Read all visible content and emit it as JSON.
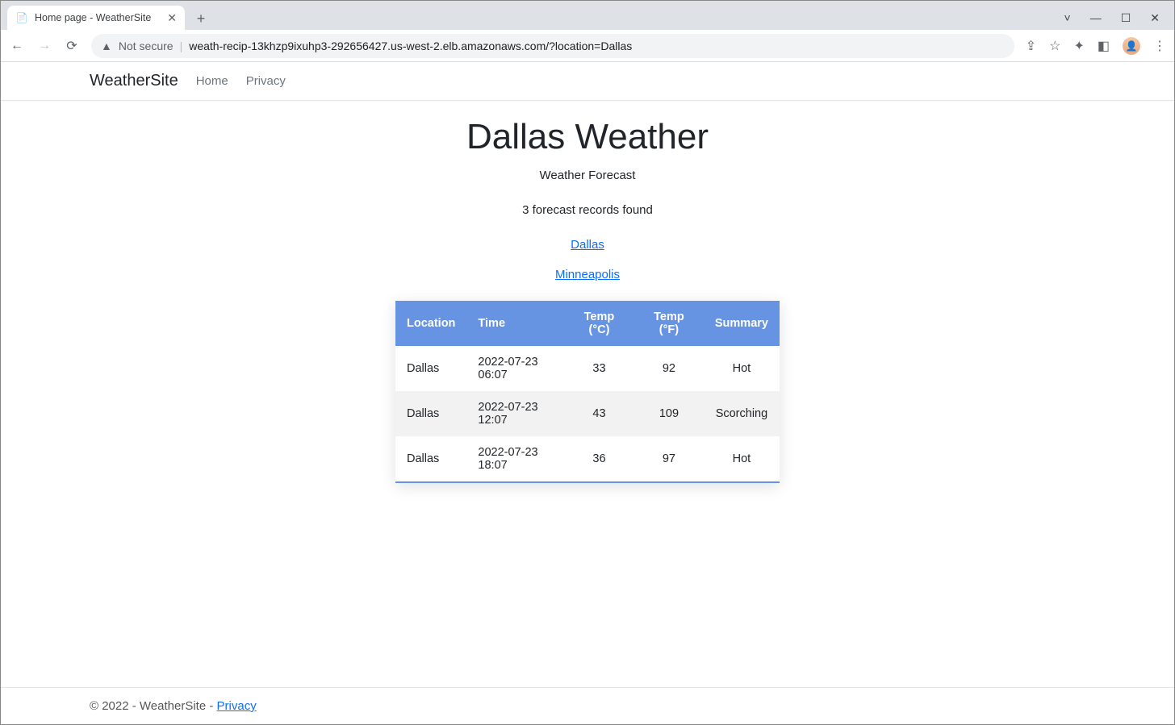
{
  "browser": {
    "tab_title": "Home page - WeatherSite",
    "not_secure_label": "Not secure",
    "url": "weath-recip-13khzp9ixuhp3-292656427.us-west-2.elb.amazonaws.com/?location=Dallas"
  },
  "nav": {
    "brand": "WeatherSite",
    "home": "Home",
    "privacy": "Privacy"
  },
  "page": {
    "title": "Dallas Weather",
    "subtitle": "Weather Forecast",
    "records_found": "3 forecast records found",
    "location_links": [
      "Dallas",
      "Minneapolis"
    ]
  },
  "table": {
    "headers": [
      "Location",
      "Time",
      "Temp (°C)",
      "Temp (°F)",
      "Summary"
    ],
    "rows": [
      {
        "location": "Dallas",
        "time": "2022-07-23 06:07",
        "temp_c": "33",
        "temp_f": "92",
        "summary": "Hot"
      },
      {
        "location": "Dallas",
        "time": "2022-07-23 12:07",
        "temp_c": "43",
        "temp_f": "109",
        "summary": "Scorching"
      },
      {
        "location": "Dallas",
        "time": "2022-07-23 18:07",
        "temp_c": "36",
        "temp_f": "97",
        "summary": "Hot"
      }
    ]
  },
  "footer": {
    "text": "© 2022 - WeatherSite - ",
    "privacy": "Privacy"
  }
}
